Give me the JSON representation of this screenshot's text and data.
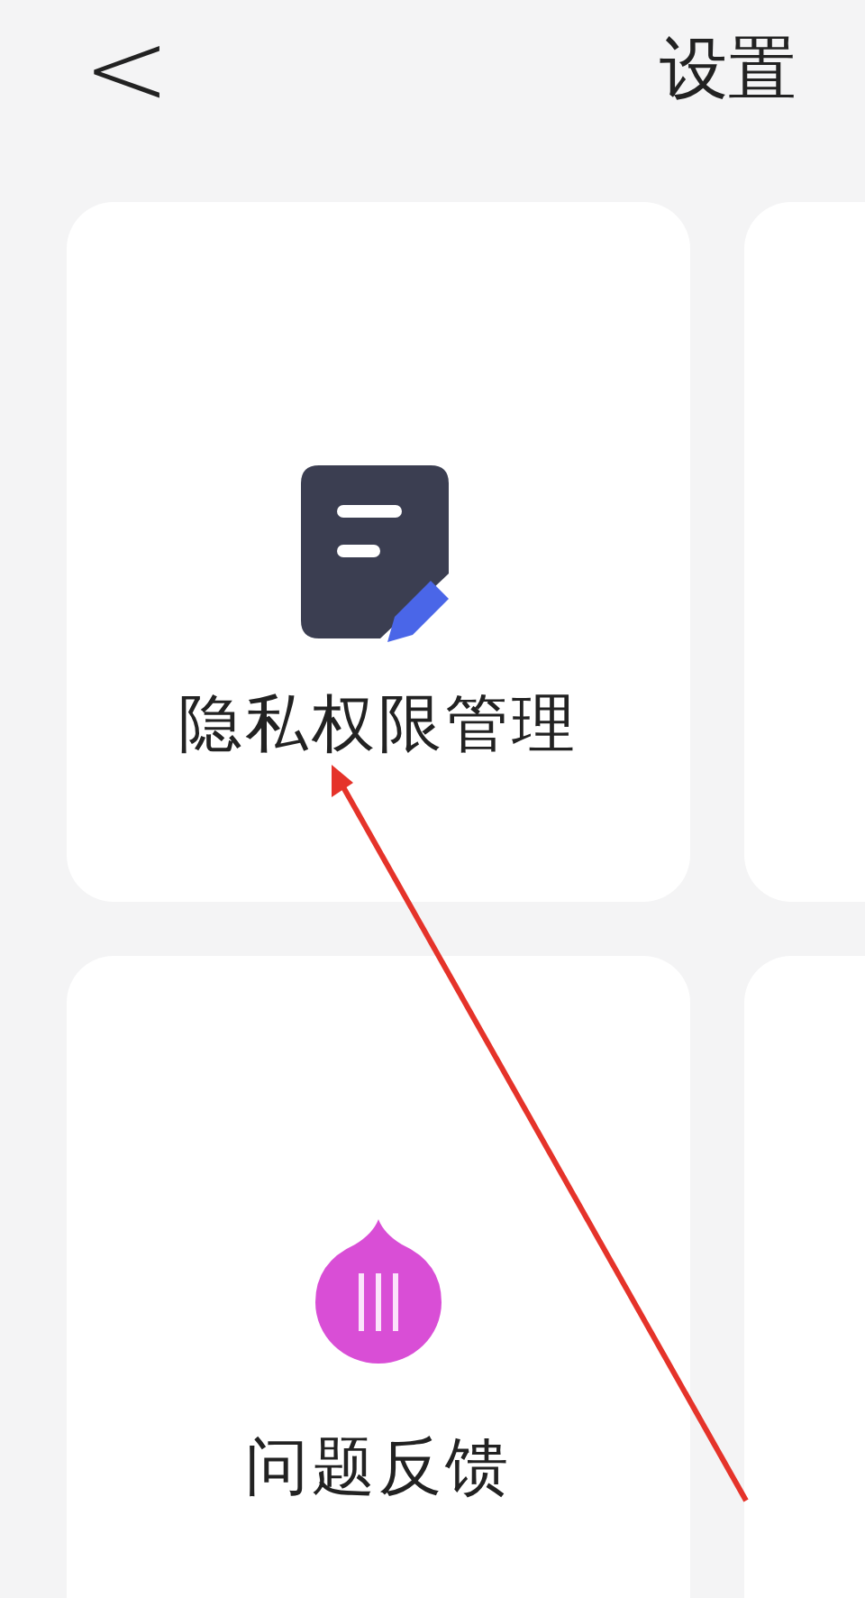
{
  "header": {
    "back": "<",
    "title": "设置"
  },
  "cards": [
    {
      "kind": "privacy",
      "label": "隐私权限管理"
    },
    {
      "kind": "blank"
    },
    {
      "kind": "feedback",
      "label": "问题反馈"
    },
    {
      "kind": "blank"
    }
  ]
}
